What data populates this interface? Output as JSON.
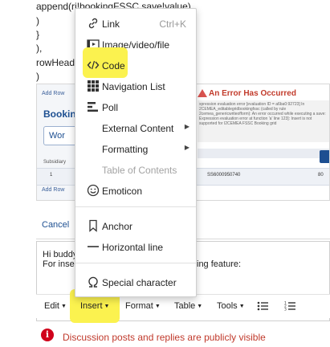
{
  "code_lines": [
    "append(ri!bookingFSSC,save!value)",
    ")",
    "}",
    "),",
    "rowHead",
    ")"
  ],
  "background_thumbnail": {
    "add_row_label": "Add Row",
    "booking_label": "Booking",
    "work_label": "Wor",
    "subsidiary_label": "Subsidiary",
    "grid_values": [
      "1",
      "SS6000950740",
      "80"
    ],
    "error_title": "An Error Has Occurred",
    "error_text": "xpression evaluation error [evaluation ID = a6ba0:92723] In 2CEMEA_editablegridbookingfssc (called by rule 2cemea_genericwriteofform): An error occurred while executing a save: Expression evaluation error at function 'a' line 123]: Insert is not supported for I2CEMEA FSSC Booking grid"
  },
  "cancel_label": "Cancel",
  "editor": {
    "line1": "Hi buddy",
    "line2_start": "For inse",
    "line2_end": "ing feature:"
  },
  "menubar": {
    "edit": "Edit",
    "insert": "Insert",
    "format": "Format",
    "table": "Table",
    "tools": "Tools"
  },
  "insert_menu": {
    "link": "Link",
    "link_shortcut": "Ctrl+K",
    "image_video_file": "Image/video/file",
    "code": "Code",
    "navigation_list": "Navigation List",
    "poll": "Poll",
    "external_content": "External Content",
    "formatting": "Formatting",
    "table_of_contents": "Table of Contents",
    "emoticon": "Emoticon",
    "anchor": "Anchor",
    "horizontal_line": "Horizontal line",
    "special_character": "Special character"
  },
  "notice_text": "Discussion posts and replies are publicly visible",
  "colors": {
    "highlight": "#fbf24f",
    "notice_red": "#c0392b",
    "link_blue": "#1d4f91"
  }
}
